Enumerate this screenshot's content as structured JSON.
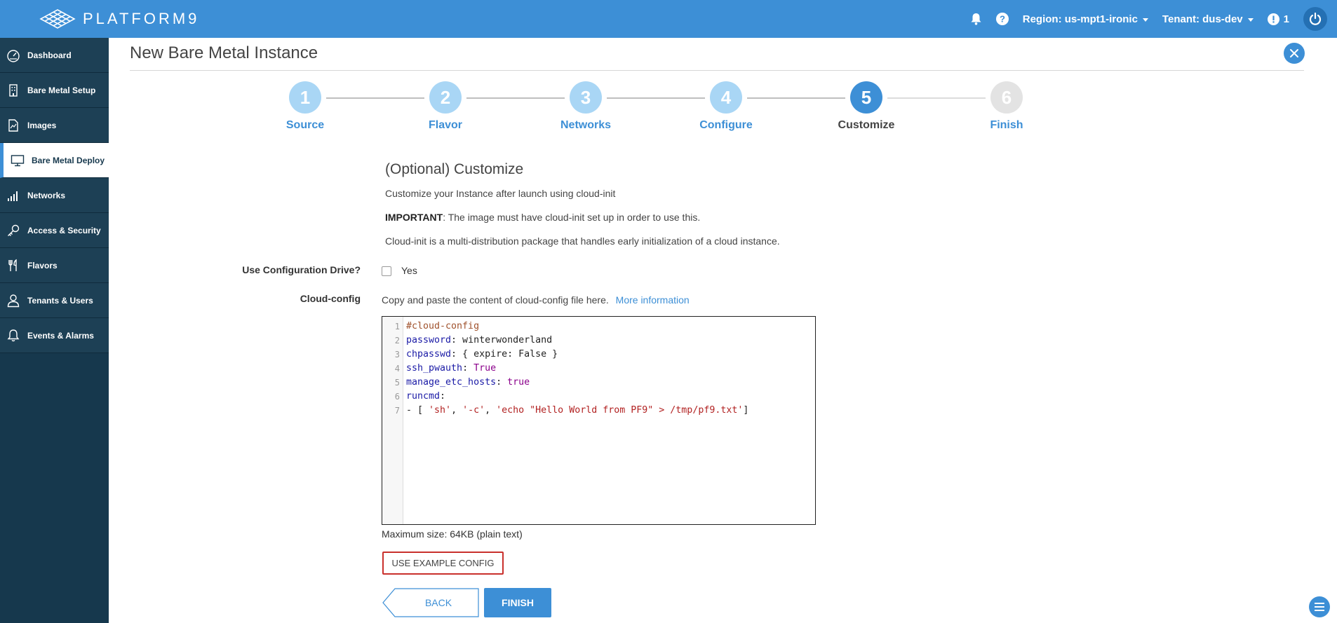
{
  "header": {
    "brand": "PLATFORM9",
    "region_label": "Region: us-mpt1-ironic",
    "tenant_label": "Tenant: dus-dev",
    "alerts_count": "1"
  },
  "sidebar": {
    "items": [
      {
        "label": "Dashboard",
        "icon": "dashboard-icon"
      },
      {
        "label": "Bare Metal Setup",
        "icon": "building-icon"
      },
      {
        "label": "Images",
        "icon": "image-file-icon"
      },
      {
        "label": "Bare Metal Deploy",
        "icon": "monitor-icon",
        "active": true
      },
      {
        "label": "Networks",
        "icon": "signal-bars-icon"
      },
      {
        "label": "Access & Security",
        "icon": "key-icon"
      },
      {
        "label": "Flavors",
        "icon": "utensils-icon"
      },
      {
        "label": "Tenants & Users",
        "icon": "user-icon"
      },
      {
        "label": "Events & Alarms",
        "icon": "bell-icon"
      }
    ]
  },
  "page": {
    "title": "New Bare Metal Instance"
  },
  "stepper": {
    "steps": [
      {
        "num": "1",
        "label": "Source",
        "state": "done"
      },
      {
        "num": "2",
        "label": "Flavor",
        "state": "done"
      },
      {
        "num": "3",
        "label": "Networks",
        "state": "done"
      },
      {
        "num": "4",
        "label": "Configure",
        "state": "done"
      },
      {
        "num": "5",
        "label": "Customize",
        "state": "current"
      },
      {
        "num": "6",
        "label": "Finish",
        "state": "future"
      }
    ]
  },
  "customize": {
    "title": "(Optional) Customize",
    "intro": "Customize your Instance after launch using cloud-init",
    "important_label": "IMPORTANT",
    "important_text": ": The image must have cloud-init set up in order to use this.",
    "description": "Cloud-init is a multi-distribution package that handles early initialization of a cloud instance.",
    "config_drive_label": "Use Configuration Drive?",
    "config_drive_option": "Yes",
    "cloud_config_label": "Cloud-config",
    "cloud_config_help": "Copy and paste the content of cloud-config file here.",
    "more_info_link": "More information",
    "code_lines": [
      "#cloud-config",
      "password: winterwonderland",
      "chpasswd: { expire: False }",
      "ssh_pwauth: True",
      "manage_etc_hosts: true",
      "runcmd:",
      "- [ 'sh', '-c', 'echo \"Hello World from PF9\" > /tmp/pf9.txt']"
    ],
    "line_numbers": [
      "1",
      "2",
      "3",
      "4",
      "5",
      "6",
      "7"
    ],
    "max_size": "Maximum size: 64KB (plain text)",
    "example_button": "USE EXAMPLE CONFIG",
    "back_button": "BACK",
    "finish_button": "FINISH"
  },
  "colors": {
    "primary": "#3d8fd6",
    "sidebar": "#16384d",
    "danger": "#c9302c"
  }
}
